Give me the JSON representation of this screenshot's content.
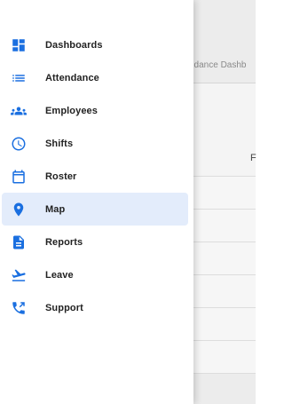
{
  "background": {
    "breadcrumb": "ndance Dashb",
    "column_header": "F"
  },
  "nav": {
    "active": "Map",
    "items": [
      {
        "label": "Dashboards",
        "icon": "dashboard-icon"
      },
      {
        "label": "Attendance",
        "icon": "list-icon"
      },
      {
        "label": "Employees",
        "icon": "people-icon"
      },
      {
        "label": "Shifts",
        "icon": "clock-icon"
      },
      {
        "label": "Roster",
        "icon": "calendar-icon"
      },
      {
        "label": "Map",
        "icon": "map-pin-icon"
      },
      {
        "label": "Reports",
        "icon": "document-icon"
      },
      {
        "label": "Leave",
        "icon": "flight-takeoff-icon"
      },
      {
        "label": "Support",
        "icon": "phone-icon"
      }
    ]
  },
  "colors": {
    "accent": "#1a6fe0",
    "active_bg": "#e3ecfb"
  }
}
